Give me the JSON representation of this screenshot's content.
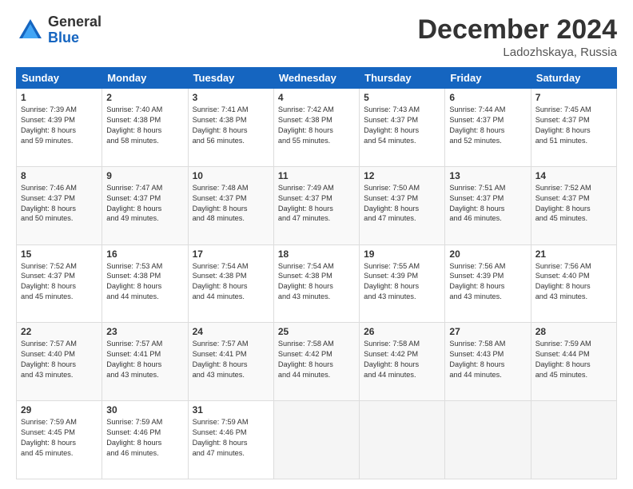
{
  "header": {
    "logo_general": "General",
    "logo_blue": "Blue",
    "month_title": "December 2024",
    "location": "Ladozhskaya, Russia"
  },
  "weekdays": [
    "Sunday",
    "Monday",
    "Tuesday",
    "Wednesday",
    "Thursday",
    "Friday",
    "Saturday"
  ],
  "weeks": [
    [
      {
        "day": "1",
        "info": "Sunrise: 7:39 AM\nSunset: 4:39 PM\nDaylight: 8 hours\nand 59 minutes."
      },
      {
        "day": "2",
        "info": "Sunrise: 7:40 AM\nSunset: 4:38 PM\nDaylight: 8 hours\nand 58 minutes."
      },
      {
        "day": "3",
        "info": "Sunrise: 7:41 AM\nSunset: 4:38 PM\nDaylight: 8 hours\nand 56 minutes."
      },
      {
        "day": "4",
        "info": "Sunrise: 7:42 AM\nSunset: 4:38 PM\nDaylight: 8 hours\nand 55 minutes."
      },
      {
        "day": "5",
        "info": "Sunrise: 7:43 AM\nSunset: 4:37 PM\nDaylight: 8 hours\nand 54 minutes."
      },
      {
        "day": "6",
        "info": "Sunrise: 7:44 AM\nSunset: 4:37 PM\nDaylight: 8 hours\nand 52 minutes."
      },
      {
        "day": "7",
        "info": "Sunrise: 7:45 AM\nSunset: 4:37 PM\nDaylight: 8 hours\nand 51 minutes."
      }
    ],
    [
      {
        "day": "8",
        "info": "Sunrise: 7:46 AM\nSunset: 4:37 PM\nDaylight: 8 hours\nand 50 minutes."
      },
      {
        "day": "9",
        "info": "Sunrise: 7:47 AM\nSunset: 4:37 PM\nDaylight: 8 hours\nand 49 minutes."
      },
      {
        "day": "10",
        "info": "Sunrise: 7:48 AM\nSunset: 4:37 PM\nDaylight: 8 hours\nand 48 minutes."
      },
      {
        "day": "11",
        "info": "Sunrise: 7:49 AM\nSunset: 4:37 PM\nDaylight: 8 hours\nand 47 minutes."
      },
      {
        "day": "12",
        "info": "Sunrise: 7:50 AM\nSunset: 4:37 PM\nDaylight: 8 hours\nand 47 minutes."
      },
      {
        "day": "13",
        "info": "Sunrise: 7:51 AM\nSunset: 4:37 PM\nDaylight: 8 hours\nand 46 minutes."
      },
      {
        "day": "14",
        "info": "Sunrise: 7:52 AM\nSunset: 4:37 PM\nDaylight: 8 hours\nand 45 minutes."
      }
    ],
    [
      {
        "day": "15",
        "info": "Sunrise: 7:52 AM\nSunset: 4:37 PM\nDaylight: 8 hours\nand 45 minutes."
      },
      {
        "day": "16",
        "info": "Sunrise: 7:53 AM\nSunset: 4:38 PM\nDaylight: 8 hours\nand 44 minutes."
      },
      {
        "day": "17",
        "info": "Sunrise: 7:54 AM\nSunset: 4:38 PM\nDaylight: 8 hours\nand 44 minutes."
      },
      {
        "day": "18",
        "info": "Sunrise: 7:54 AM\nSunset: 4:38 PM\nDaylight: 8 hours\nand 43 minutes."
      },
      {
        "day": "19",
        "info": "Sunrise: 7:55 AM\nSunset: 4:39 PM\nDaylight: 8 hours\nand 43 minutes."
      },
      {
        "day": "20",
        "info": "Sunrise: 7:56 AM\nSunset: 4:39 PM\nDaylight: 8 hours\nand 43 minutes."
      },
      {
        "day": "21",
        "info": "Sunrise: 7:56 AM\nSunset: 4:40 PM\nDaylight: 8 hours\nand 43 minutes."
      }
    ],
    [
      {
        "day": "22",
        "info": "Sunrise: 7:57 AM\nSunset: 4:40 PM\nDaylight: 8 hours\nand 43 minutes."
      },
      {
        "day": "23",
        "info": "Sunrise: 7:57 AM\nSunset: 4:41 PM\nDaylight: 8 hours\nand 43 minutes."
      },
      {
        "day": "24",
        "info": "Sunrise: 7:57 AM\nSunset: 4:41 PM\nDaylight: 8 hours\nand 43 minutes."
      },
      {
        "day": "25",
        "info": "Sunrise: 7:58 AM\nSunset: 4:42 PM\nDaylight: 8 hours\nand 44 minutes."
      },
      {
        "day": "26",
        "info": "Sunrise: 7:58 AM\nSunset: 4:42 PM\nDaylight: 8 hours\nand 44 minutes."
      },
      {
        "day": "27",
        "info": "Sunrise: 7:58 AM\nSunset: 4:43 PM\nDaylight: 8 hours\nand 44 minutes."
      },
      {
        "day": "28",
        "info": "Sunrise: 7:59 AM\nSunset: 4:44 PM\nDaylight: 8 hours\nand 45 minutes."
      }
    ],
    [
      {
        "day": "29",
        "info": "Sunrise: 7:59 AM\nSunset: 4:45 PM\nDaylight: 8 hours\nand 45 minutes."
      },
      {
        "day": "30",
        "info": "Sunrise: 7:59 AM\nSunset: 4:46 PM\nDaylight: 8 hours\nand 46 minutes."
      },
      {
        "day": "31",
        "info": "Sunrise: 7:59 AM\nSunset: 4:46 PM\nDaylight: 8 hours\nand 47 minutes."
      },
      {
        "day": "",
        "info": ""
      },
      {
        "day": "",
        "info": ""
      },
      {
        "day": "",
        "info": ""
      },
      {
        "day": "",
        "info": ""
      }
    ]
  ]
}
